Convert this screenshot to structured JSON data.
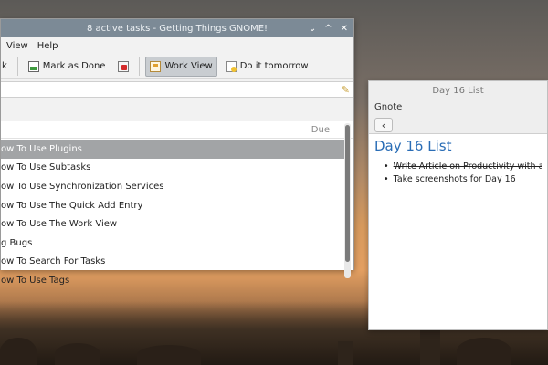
{
  "gtg": {
    "title": "8 active tasks - Getting Things GNOME!",
    "controls": [
      "⌄",
      "^",
      "✕"
    ],
    "menu": [
      "View",
      "Help"
    ],
    "toolbar": {
      "k_fragment": "k",
      "mark_done": "Mark as Done",
      "work_view": "Work View",
      "do_tomorrow": "Do it tomorrow"
    },
    "column_due": "Due",
    "tasks": [
      "ow To Use Plugins",
      "ow To Use Subtasks",
      "ow To Use Synchronization Services",
      "ow To Use The Quick Add Entry",
      "ow To Use The Work View",
      "g Bugs",
      "ow To Search For Tasks",
      "ow To Use Tags"
    ]
  },
  "gnote": {
    "title": "Day 16 List",
    "app_label": "Gnote",
    "back_glyph": "‹",
    "heading": "Day 16 List",
    "items": [
      {
        "text": "Write Article on Productivity with a",
        "struck": true
      },
      {
        "text": "Take screenshots for Day 16",
        "struck": false
      }
    ]
  }
}
